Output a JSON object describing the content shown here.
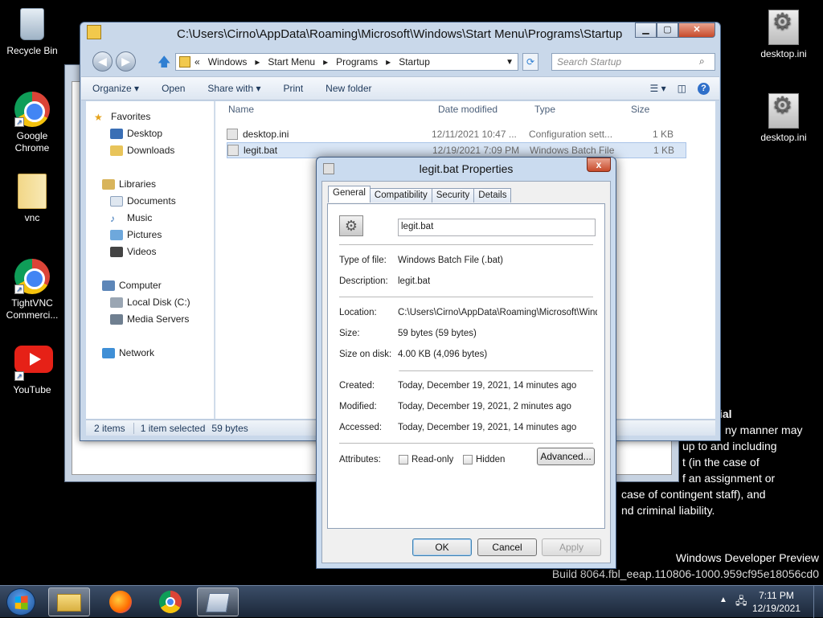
{
  "desktop": {
    "icons_left": [
      {
        "label": "Recycle Bin"
      },
      {
        "label": "Google Chrome"
      },
      {
        "label": "vnc"
      },
      {
        "label": "TightVNC Commerci..."
      },
      {
        "label": "YouTube"
      }
    ],
    "icons_right": [
      {
        "label": "desktop.ini"
      },
      {
        "label": "desktop.ini"
      }
    ],
    "legal_text": {
      "line1": "ial",
      "line2": "ny manner may",
      "line3": "up to and including",
      "line4": "t (in the case of",
      "line5": "f an assignment or",
      "line6": "case of contingent staff), and",
      "line7": "nd criminal liability."
    },
    "watermark": {
      "line1": "Windows Developer Preview",
      "line2": "Build 8064.fbl_eeap.110806-1000.959cf95e18056cd0"
    }
  },
  "explorer": {
    "title": "C:\\Users\\Cirno\\AppData\\Roaming\\Microsoft\\Windows\\Start Menu\\Programs\\Startup",
    "address": {
      "prefix": "«",
      "crumbs": [
        "Windows",
        "Start Menu",
        "Programs",
        "Startup"
      ]
    },
    "search_placeholder": "Search Startup",
    "toolbar": {
      "organize": "Organize ▾",
      "open": "Open",
      "share": "Share with ▾",
      "print": "Print",
      "new_folder": "New folder"
    },
    "nav": {
      "favorites": "Favorites",
      "desktop": "Desktop",
      "downloads": "Downloads",
      "libraries": "Libraries",
      "documents": "Documents",
      "music": "Music",
      "pictures": "Pictures",
      "videos": "Videos",
      "computer": "Computer",
      "local_disk": "Local Disk (C:)",
      "media_servers": "Media Servers",
      "network": "Network"
    },
    "columns": {
      "name": "Name",
      "date": "Date modified",
      "type": "Type",
      "size": "Size"
    },
    "files": [
      {
        "name": "desktop.ini",
        "date": "12/11/2021 10:47 ...",
        "type": "Configuration sett...",
        "size": "1 KB"
      },
      {
        "name": "legit.bat",
        "date": "12/19/2021 7:09 PM",
        "type": "Windows Batch File",
        "size": "1 KB"
      }
    ],
    "status": {
      "count": "2 items",
      "selected": "1 item selected",
      "bytes": "59 bytes"
    }
  },
  "dialog": {
    "title": "legit.bat Properties",
    "close": "x",
    "tabs": [
      "General",
      "Compatibility",
      "Security",
      "Details"
    ],
    "filename": "legit.bat",
    "fields": {
      "type_label": "Type of file:",
      "type_value": "Windows Batch File (.bat)",
      "desc_label": "Description:",
      "desc_value": "legit.bat",
      "location_label": "Location:",
      "location_value": "C:\\Users\\Cirno\\AppData\\Roaming\\Microsoft\\Windo",
      "size_label": "Size:",
      "size_value": "59 bytes (59 bytes)",
      "disk_label": "Size on disk:",
      "disk_value": "4.00 KB (4,096 bytes)",
      "created_label": "Created:",
      "created_value": "Today, December 19, 2021, 14 minutes ago",
      "modified_label": "Modified:",
      "modified_value": "Today, December 19, 2021, 2 minutes ago",
      "accessed_label": "Accessed:",
      "accessed_value": "Today, December 19, 2021, 14 minutes ago",
      "attributes_label": "Attributes:",
      "readonly": "Read-only",
      "hidden": "Hidden",
      "advanced": "Advanced..."
    },
    "buttons": {
      "ok": "OK",
      "cancel": "Cancel",
      "apply": "Apply"
    }
  },
  "taskbar": {
    "time": "7:11 PM",
    "date": "12/19/2021"
  }
}
